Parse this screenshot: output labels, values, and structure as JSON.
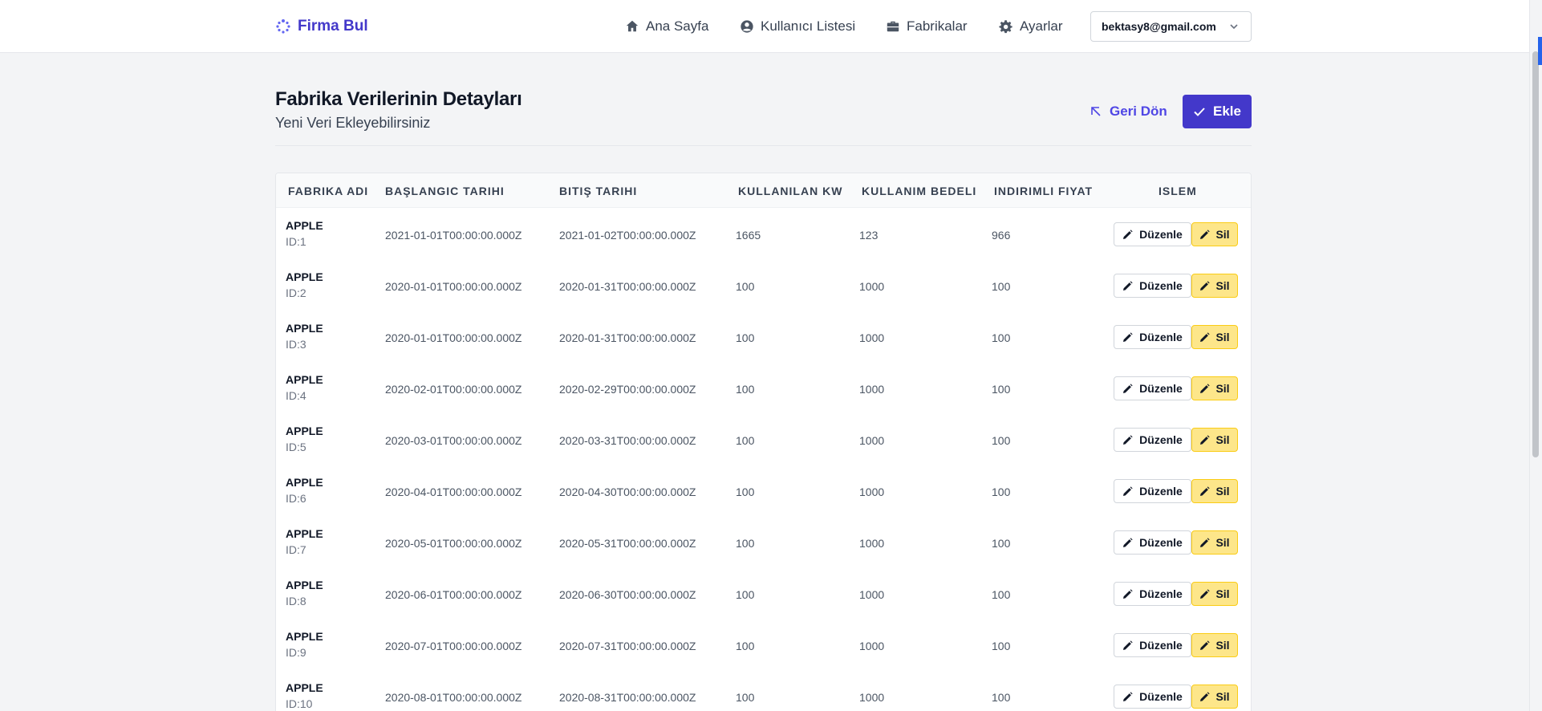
{
  "header": {
    "brand": "Firma Bul",
    "nav": {
      "home": "Ana Sayfa",
      "users": "Kullanıcı Listesi",
      "factories": "Fabrikalar",
      "settings": "Ayarlar"
    },
    "user_email": "bektasy8@gmail.com"
  },
  "page": {
    "title": "Fabrika Verilerinin Detayları",
    "subtitle": "Yeni Veri Ekleyebilirsiniz",
    "back_label": "Geri Dön",
    "add_label": "Ekle"
  },
  "table": {
    "headers": {
      "name": "FABRIKA ADI",
      "start": "BAŞLANGIC TARIHI",
      "end": "BITIŞ TARIHI",
      "kw": "KULLANILAN KW",
      "cost": "KULLANIM BEDELI",
      "discount": "INDIRIMLI FIYAT",
      "action": "ISLEM"
    },
    "edit_label": "Düzenle",
    "delete_label": "Sil",
    "rows": [
      {
        "name": "APPLE",
        "id": "ID:1",
        "start": "2021-01-01T00:00:00.000Z",
        "end": "2021-01-02T00:00:00.000Z",
        "kw": "1665",
        "cost": "123",
        "discount": "966"
      },
      {
        "name": "APPLE",
        "id": "ID:2",
        "start": "2020-01-01T00:00:00.000Z",
        "end": "2020-01-31T00:00:00.000Z",
        "kw": "100",
        "cost": "1000",
        "discount": "100"
      },
      {
        "name": "APPLE",
        "id": "ID:3",
        "start": "2020-01-01T00:00:00.000Z",
        "end": "2020-01-31T00:00:00.000Z",
        "kw": "100",
        "cost": "1000",
        "discount": "100"
      },
      {
        "name": "APPLE",
        "id": "ID:4",
        "start": "2020-02-01T00:00:00.000Z",
        "end": "2020-02-29T00:00:00.000Z",
        "kw": "100",
        "cost": "1000",
        "discount": "100"
      },
      {
        "name": "APPLE",
        "id": "ID:5",
        "start": "2020-03-01T00:00:00.000Z",
        "end": "2020-03-31T00:00:00.000Z",
        "kw": "100",
        "cost": "1000",
        "discount": "100"
      },
      {
        "name": "APPLE",
        "id": "ID:6",
        "start": "2020-04-01T00:00:00.000Z",
        "end": "2020-04-30T00:00:00.000Z",
        "kw": "100",
        "cost": "1000",
        "discount": "100"
      },
      {
        "name": "APPLE",
        "id": "ID:7",
        "start": "2020-05-01T00:00:00.000Z",
        "end": "2020-05-31T00:00:00.000Z",
        "kw": "100",
        "cost": "1000",
        "discount": "100"
      },
      {
        "name": "APPLE",
        "id": "ID:8",
        "start": "2020-06-01T00:00:00.000Z",
        "end": "2020-06-30T00:00:00.000Z",
        "kw": "100",
        "cost": "1000",
        "discount": "100"
      },
      {
        "name": "APPLE",
        "id": "ID:9",
        "start": "2020-07-01T00:00:00.000Z",
        "end": "2020-07-31T00:00:00.000Z",
        "kw": "100",
        "cost": "1000",
        "discount": "100"
      },
      {
        "name": "APPLE",
        "id": "ID:10",
        "start": "2020-08-01T00:00:00.000Z",
        "end": "2020-08-31T00:00:00.000Z",
        "kw": "100",
        "cost": "1000",
        "discount": "100"
      }
    ]
  },
  "icons": {
    "brand": "spinner-logo-icon",
    "home": "home-icon",
    "users": "user-circle-icon",
    "factories": "briefcase-icon",
    "settings": "gear-icon",
    "user_menu": "chevron-down-icon",
    "back": "arrow-up-left-icon",
    "add": "check-icon",
    "edit": "pencil-icon",
    "delete": "pencil-icon"
  },
  "colors": {
    "brand": "#4338ca",
    "add_button": "#4338ca",
    "delete_button": "#fde68a",
    "page_background": "#f3f4f6"
  }
}
